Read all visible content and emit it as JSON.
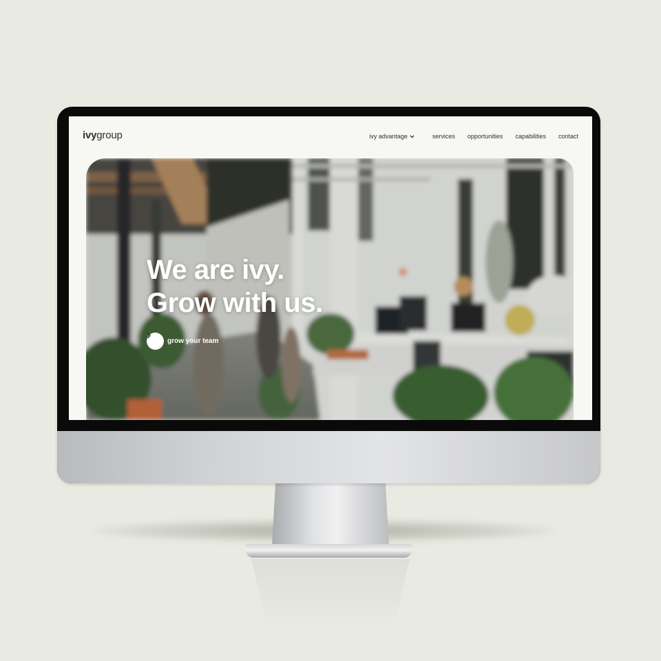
{
  "site": {
    "logo_bold": "ivy",
    "logo_light": "group",
    "nav": [
      {
        "label": "ivy advantage",
        "has_dropdown": true
      },
      {
        "label": "services"
      },
      {
        "label": "opportunities"
      },
      {
        "label": "capabilities"
      },
      {
        "label": "contact"
      }
    ],
    "hero": {
      "line1": "We are ivy.",
      "line2": "Grow with us.",
      "cta_label": "grow your team",
      "cta_icon": "chevron-right-icon",
      "image": "blurred office interior with plants"
    }
  },
  "colors": {
    "background": "#e9ebe3",
    "site_bg": "#f7f8f3",
    "text_dark": "#2e302c",
    "hero_text": "#ffffff"
  }
}
